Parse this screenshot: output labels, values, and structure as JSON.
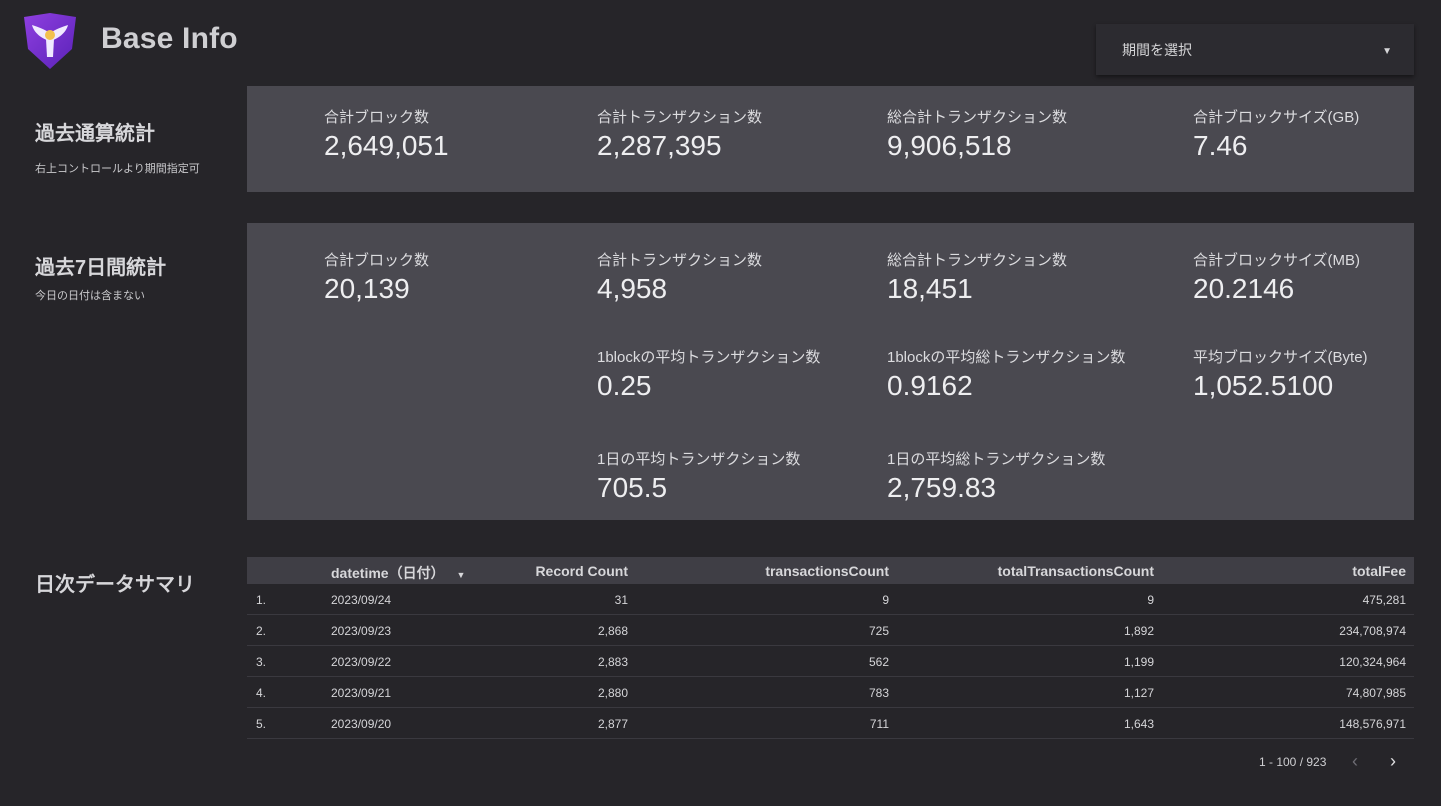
{
  "header": {
    "title": "Base Info",
    "period_select_label": "期間を選択",
    "logo_icon": "base-info-shield-logo"
  },
  "section_all_time": {
    "title": "過去通算統計",
    "note": "右上コントロールより期間指定可",
    "metrics": [
      {
        "label": "合計ブロック数",
        "value": "2,649,051"
      },
      {
        "label": "合計トランザクション数",
        "value": "2,287,395"
      },
      {
        "label": "総合計トランザクション数",
        "value": "9,906,518"
      },
      {
        "label": "合計ブロックサイズ(GB)",
        "value": "7.46"
      }
    ]
  },
  "section_7days": {
    "title": "過去7日間統計",
    "note": "今日の日付は含まない",
    "metrics": [
      {
        "label": "合計ブロック数",
        "value": "20,139"
      },
      {
        "label": "合計トランザクション数",
        "value": "4,958"
      },
      {
        "label": "総合計トランザクション数",
        "value": "18,451"
      },
      {
        "label": "合計ブロックサイズ(MB)",
        "value": "20.2146"
      },
      {
        "label": "1blockの平均トランザクション数",
        "value": "0.25"
      },
      {
        "label": "1blockの平均総トランザクション数",
        "value": "0.9162"
      },
      {
        "label": "平均ブロックサイズ(Byte)",
        "value": "1,052.5100"
      },
      {
        "label": "1日の平均トランザクション数",
        "value": "705.5"
      },
      {
        "label": "1日の平均総トランザクション数",
        "value": "2,759.83"
      }
    ]
  },
  "section_daily": {
    "title": "日次データサマリ",
    "columns": {
      "datetime": "datetime（日付）",
      "record_count": "Record Count",
      "transactions": "transactionsCount",
      "total_transactions": "totalTransactionsCount",
      "total_fee": "totalFee"
    },
    "sort_icon": "sort-down-caret",
    "rows": [
      {
        "idx": "1.",
        "date": "2023/09/24",
        "rc": "31",
        "tc": "9",
        "ttc": "9",
        "fee": "475,281"
      },
      {
        "idx": "2.",
        "date": "2023/09/23",
        "rc": "2,868",
        "tc": "725",
        "ttc": "1,892",
        "fee": "234,708,974"
      },
      {
        "idx": "3.",
        "date": "2023/09/22",
        "rc": "2,883",
        "tc": "562",
        "ttc": "1,199",
        "fee": "120,324,964"
      },
      {
        "idx": "4.",
        "date": "2023/09/21",
        "rc": "2,880",
        "tc": "783",
        "ttc": "1,127",
        "fee": "74,807,985"
      },
      {
        "idx": "5.",
        "date": "2023/09/20",
        "rc": "2,877",
        "tc": "711",
        "ttc": "1,643",
        "fee": "148,576,971"
      }
    ],
    "pagination": "1 - 100 / 923"
  }
}
